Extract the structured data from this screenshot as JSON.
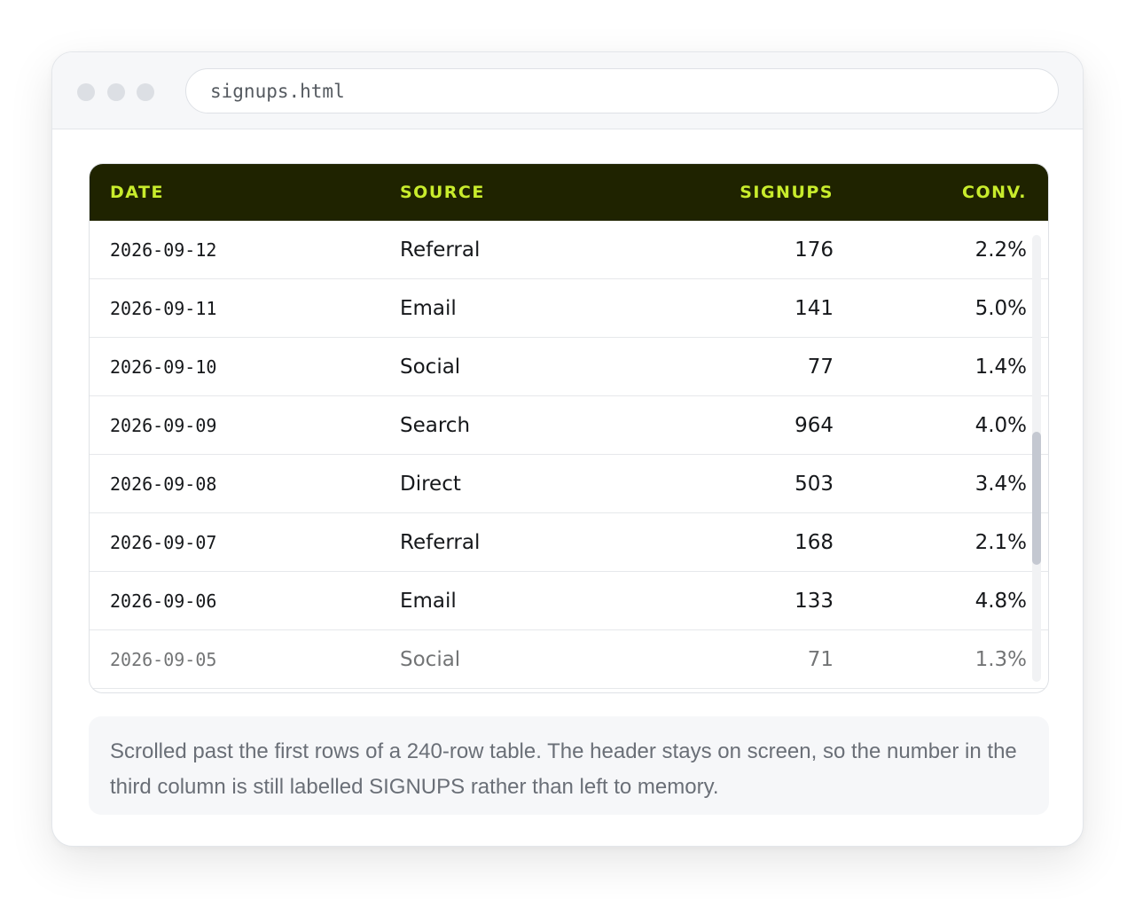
{
  "window": {
    "address": "signups.html"
  },
  "table": {
    "headers": [
      "DATE",
      "SOURCE",
      "SIGNUPS",
      "CONV."
    ],
    "rows": [
      {
        "date": "2026-09-12",
        "source": "Referral",
        "signups": "176",
        "conv": "2.2%"
      },
      {
        "date": "2026-09-11",
        "source": "Email",
        "signups": "141",
        "conv": "5.0%"
      },
      {
        "date": "2026-09-10",
        "source": "Social",
        "signups": "77",
        "conv": "1.4%"
      },
      {
        "date": "2026-09-09",
        "source": "Search",
        "signups": "964",
        "conv": "4.0%"
      },
      {
        "date": "2026-09-08",
        "source": "Direct",
        "signups": "503",
        "conv": "3.4%"
      },
      {
        "date": "2026-09-07",
        "source": "Referral",
        "signups": "168",
        "conv": "2.1%"
      },
      {
        "date": "2026-09-06",
        "source": "Email",
        "signups": "133",
        "conv": "4.8%"
      },
      {
        "date": "2026-09-05",
        "source": "Social",
        "signups": "71",
        "conv": "1.3%"
      }
    ]
  },
  "caption": "Scrolled past the first rows of a 240-row table. The header stays on screen, so the number in the third column is still labelled SIGNUPS rather than left to memory.",
  "colors": {
    "header_bg": "#1f2300",
    "header_text": "#c8ec2c",
    "scroll_thumb": "#c4c8d1"
  }
}
